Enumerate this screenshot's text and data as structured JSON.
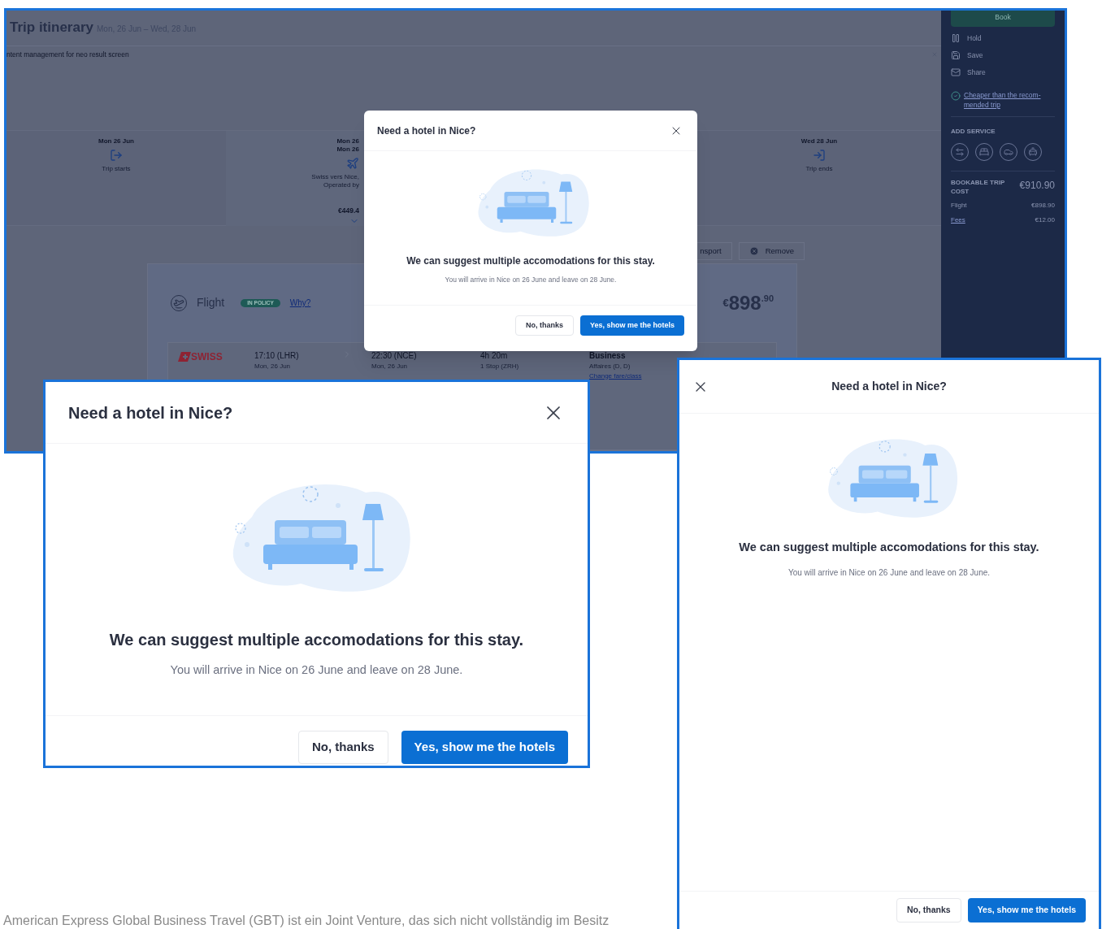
{
  "background_screen": {
    "header": {
      "title": "Trip itinerary",
      "dates": "Mon, 26 Jun – Wed, 28 Jun"
    },
    "notice": "ntent management for neo result screen",
    "timeline": [
      {
        "kind": "start",
        "date_lines": [
          "Mon 26 Jun"
        ],
        "caption_lines": [
          "Trip starts"
        ]
      },
      {
        "kind": "flight",
        "date_lines": [
          "Mon 26",
          "Mon 26"
        ],
        "caption_lines": [
          "Swiss vers Nice,",
          "Operated by"
        ],
        "price": "€449.4"
      },
      {
        "kind": "end",
        "date_lines": [
          "Wed 28 Jun"
        ],
        "caption_lines": [
          "Trip ends"
        ]
      }
    ],
    "actions": [
      {
        "kind": "plain",
        "label": "nsport"
      },
      {
        "kind": "remove",
        "label": "Remove"
      }
    ],
    "flight_card": {
      "title": "Flight",
      "badge": "IN POLICY",
      "link": "Why?",
      "price": {
        "currency": "€",
        "whole": "898",
        "cents": ".90"
      },
      "segment": {
        "airline": "SWISS",
        "departure": {
          "time": "17:10 (LHR)",
          "date": "Mon, 26 Jun"
        },
        "arrival": {
          "time": "22:30 (NCE)",
          "date": "Mon, 26 Jun"
        },
        "duration": {
          "time": "4h 20m",
          "stops": "1 Stop (ZRH)"
        },
        "fare": {
          "cabin": "Business",
          "code": "Affaires (D, D)",
          "link": "Change fare/class"
        }
      }
    },
    "sidebar": {
      "book": "Book",
      "actions": [
        {
          "kind": "hold",
          "label": "Hold"
        },
        {
          "kind": "save",
          "label": "Save"
        },
        {
          "kind": "share",
          "label": "Share"
        }
      ],
      "note_lines": [
        "Cheaper than the recom-",
        "mended trip"
      ],
      "add_service": "ADD SERVICE",
      "services": [
        {
          "kind": "transfer"
        },
        {
          "kind": "hotel"
        },
        {
          "kind": "car"
        },
        {
          "kind": "taxi"
        }
      ],
      "cost": {
        "label": "BOOKABLE TRIP COST",
        "total": "€910.90",
        "lines": [
          {
            "kind": "plain",
            "label": "Flight",
            "value": "€898.90"
          },
          {
            "kind": "link",
            "label": "Fees",
            "value": "€12.00"
          }
        ]
      }
    },
    "dialog": {
      "kind": "small",
      "title": "Need a hotel in Nice?",
      "headline": "We can suggest multiple accomodations for this stay.",
      "subtext": "You will arrive in Nice on 26 June and leave on 28 June.",
      "buttons": [
        {
          "kind": "secondary",
          "label": "No, thanks"
        },
        {
          "kind": "primary",
          "label": "Yes, show me the hotels"
        }
      ]
    }
  },
  "dialogs": [
    {
      "kind": "large",
      "title": "Need a hotel in Nice?",
      "headline": "We can suggest multiple accomodations for this stay.",
      "subtext": "You will arrive in Nice on 26 June and leave on 28 June.",
      "buttons": [
        {
          "kind": "secondary",
          "label": "No, thanks"
        },
        {
          "kind": "primary",
          "label": "Yes, show me the hotels"
        }
      ]
    },
    {
      "kind": "mobile",
      "title": "Need a hotel in Nice?",
      "headline": "We can suggest multiple accomodations for this stay.",
      "subtext": "You will arrive in Nice on 26 June and leave on 28 June.",
      "buttons": [
        {
          "kind": "secondary",
          "label": "No, thanks"
        },
        {
          "kind": "primary",
          "label": "Yes, show me the hotels"
        }
      ]
    }
  ],
  "footer_text": "American Express Global Business Travel (GBT) ist ein Joint Venture, das sich nicht vollständig im Besitz"
}
